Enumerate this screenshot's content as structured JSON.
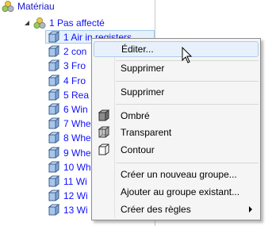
{
  "tree": {
    "root_label": "Matériau",
    "group_label": "1 Pas affecté",
    "items": [
      "1 Air in registers",
      "2 con",
      "3 Fro",
      "4 Fro",
      "5 Rea",
      "6 Win",
      "7 Whe",
      "8 Whe",
      "9 Whe",
      "10 Wh",
      "11 Wi",
      "12 Wi",
      "13 Wi"
    ]
  },
  "context_menu": {
    "edit": "Éditer...",
    "delete_1": "Supprimer",
    "delete_2": "Supprimer",
    "shaded": "Ombré",
    "transparent": "Transparent",
    "outline": "Contour",
    "new_group": "Créer un nouveau groupe...",
    "add_to_group": "Ajouter au groupe existant...",
    "create_rules": "Créer des règles"
  },
  "icons": {
    "tree_root": "material-group-icon",
    "tree_group": "material-group-icon",
    "tree_item": "cube-icon",
    "shaded": "shaded-cube-icon",
    "transparent": "transparent-cube-icon",
    "outline": "outline-cube-icon"
  },
  "colors": {
    "tree_text": "#1010ff",
    "selection_bg": "#e5f1fb",
    "menu_hover_bg": "#e8f1fb"
  }
}
